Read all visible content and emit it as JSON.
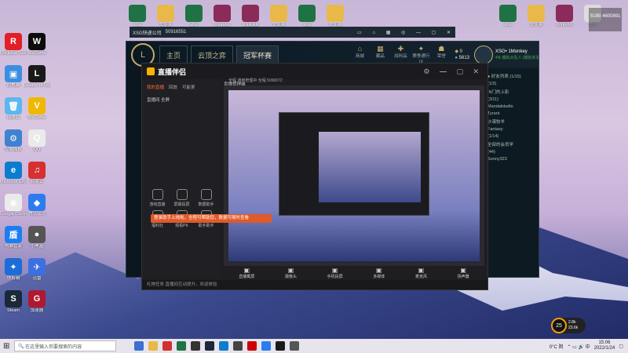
{
  "desktop": {
    "left_icons": [
      {
        "label": "Rockstar Games Launcher",
        "color": "#e21f26",
        "glyph": "R"
      },
      {
        "label": "此电脑",
        "color": "#3c8ee0",
        "glyph": "▣"
      },
      {
        "label": "回收站",
        "color": "#5bb7f0",
        "glyph": "🗑"
      },
      {
        "label": "控制面板",
        "color": "#3e82d0",
        "glyph": "⚙"
      },
      {
        "label": "Microsoft Edge",
        "color": "#0b7dcf",
        "glyph": "e"
      },
      {
        "label": "Google Chrome",
        "color": "#eaeaea",
        "glyph": "◉"
      },
      {
        "label": "电脑管家",
        "color": "#1a7ef0",
        "glyph": "盾"
      },
      {
        "label": "快剪辑",
        "color": "#1c6cd9",
        "glyph": "✦"
      },
      {
        "label": "Steam",
        "color": "#1b2838",
        "glyph": "S"
      }
    ],
    "col2_icons": [
      {
        "label": "WeGame",
        "color": "#0c0c0c",
        "glyph": "W"
      },
      {
        "label": "League of Legends",
        "color": "#1a1a1a",
        "glyph": "L"
      },
      {
        "label": "WeGame",
        "color": "#f0b800",
        "glyph": "V"
      },
      {
        "label": "QQ",
        "color": "#eaeaea",
        "glyph": "Q"
      },
      {
        "label": "网易云",
        "color": "#d63030",
        "glyph": "♫"
      },
      {
        "label": "腾讯会议",
        "color": "#2c7cf0",
        "glyph": "◆"
      },
      {
        "label": "小黑盒",
        "color": "#555",
        "glyph": "●"
      },
      {
        "label": "迅雷",
        "color": "#3d6fe0",
        "glyph": "✈"
      },
      {
        "label": "加速器",
        "color": "#b0182f",
        "glyph": "G"
      }
    ],
    "top_icons": [
      {
        "label": "xlsx",
        "color": "#1f7244"
      },
      {
        "label": "文件夹",
        "color": "#e8b948"
      },
      {
        "label": "xlsx",
        "color": "#1f7244"
      },
      {
        "label": "WinRAR",
        "color": "#8a2b5a"
      },
      {
        "label": "WinRAR",
        "color": "#8a2b5a"
      },
      {
        "label": "文件夹",
        "color": "#e8b948"
      },
      {
        "label": "xlsx",
        "color": "#1f7244"
      },
      {
        "label": "文件夹",
        "color": "#e8b948"
      }
    ],
    "right_icons": [
      {
        "label": "xlsx",
        "color": "#1f7244"
      },
      {
        "label": "文件夹",
        "color": "#e8b948"
      },
      {
        "label": "WinRAR",
        "color": "#8a2b5a"
      },
      {
        "label": "文件",
        "color": "#ddd"
      }
    ]
  },
  "client": {
    "title": "XSG快递公司",
    "id": "50916551",
    "nav": [
      "主页",
      "云顶之弈",
      "冠军杯赛"
    ],
    "tools": [
      {
        "label": "商城",
        "glyph": "⌂"
      },
      {
        "label": "藏品",
        "glyph": "▦"
      },
      {
        "label": "战利品",
        "glyph": "✚"
      },
      {
        "label": "赛季通行证",
        "glyph": "✦"
      },
      {
        "label": "荣誉",
        "glyph": "☗"
      }
    ],
    "currency_be": "0",
    "currency_rp": "5613",
    "player": "XSG• 1Monkey",
    "player_status": "4% 模拟大队人 (模拟实测)",
    "friends": [
      "● 好友列表 (1/15)",
      "(1/3)",
      "IN门的上影",
      "(3/11)",
      "Mandalstudio",
      "Tyrant",
      "沙漠牧羊",
      "Fantasy",
      "(1/14)",
      "全部的会员学",
      "(44)",
      "Sunny323"
    ]
  },
  "stream": {
    "app_name": "直播伴侣",
    "tabs": [
      "我的直播",
      "回放",
      "可能更"
    ],
    "subheader": "直播间  全屏",
    "tools": [
      "游戏直播",
      "屏幕投屏",
      "数据助手",
      "福利社",
      "观看PK",
      "助手助手"
    ],
    "banner": "登录助手上线啦，全程可帮助您，数据可随时查看",
    "bottom": [
      "直播截屏",
      "摄像头",
      "手机投屏",
      "多媒体",
      "麦克风",
      "扬声器"
    ],
    "status_text": "礼物任务  直播间互动提升，欢迎体验",
    "window_title": "直播管理端",
    "breadcrumb": "全程  通用管理中  全程  5090072"
  },
  "taskbar": {
    "search_placeholder": "在这里输入你要搜索的内容",
    "temp": "0°C 阴",
    "time": "15:06",
    "date": "2022/1/24"
  },
  "overlay": {
    "watermark": "SUBI 4600891",
    "gauge_value": "25",
    "gauge_up": "2.8k",
    "gauge_down": "23.6k"
  }
}
